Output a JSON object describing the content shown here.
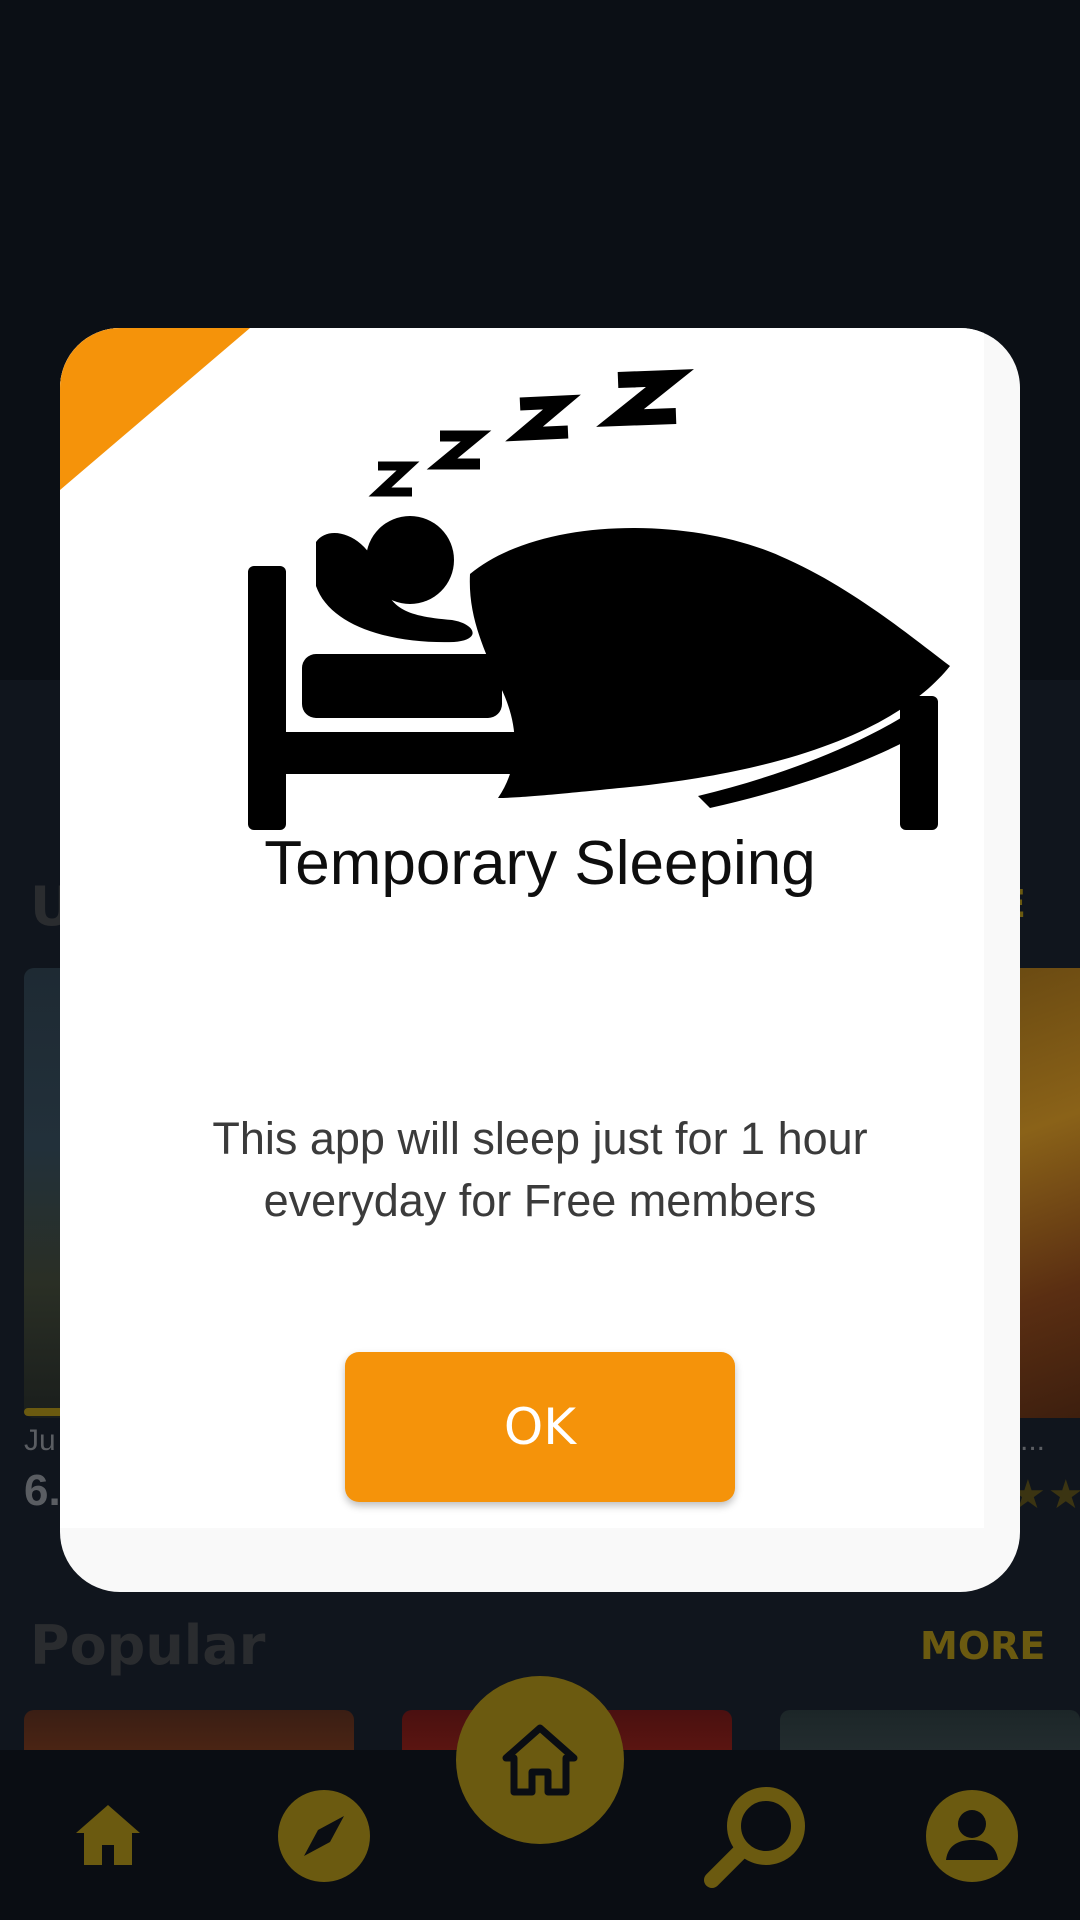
{
  "background": {
    "upcoming_title_fragment": "U",
    "upcoming_more_fragment": "E",
    "left_movie_title_fragment": "Ju",
    "left_movie_rating_fragment": "6.",
    "right_movie_title_fragment": "...",
    "right_movie_stars": "★★",
    "popular_title": "Popular",
    "popular_more": "MORE"
  },
  "bottom_nav": {
    "items": [
      {
        "icon": "home-icon"
      },
      {
        "icon": "compass-icon"
      },
      {
        "icon": "home-center-icon"
      },
      {
        "icon": "search-icon"
      },
      {
        "icon": "profile-icon"
      }
    ]
  },
  "dialog": {
    "illustration": "sleeping-in-bed-icon",
    "title": "Temporary Sleeping",
    "message": "This app will sleep just for 1 hour everyday for Free members",
    "ok_label": "OK"
  },
  "colors": {
    "accent": "#f5930a",
    "nav_gold_dimmed": "#6b5a10",
    "background": "#0b0f15",
    "dialog": "#ffffff"
  }
}
